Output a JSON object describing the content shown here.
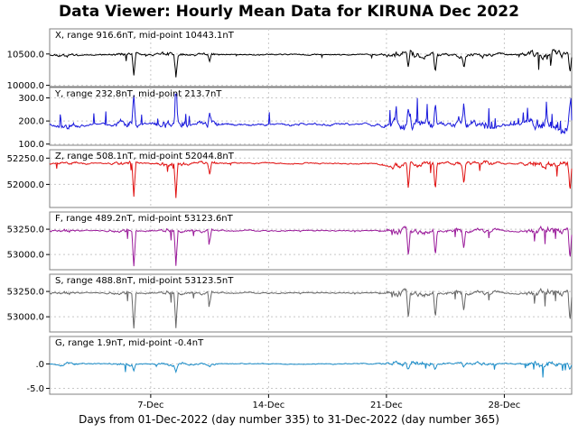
{
  "title": "Data Viewer:  Hourly Mean Data for KIRUNA Dec 2022",
  "chart_data": {
    "type": "line",
    "title": "Data Viewer:  Hourly Mean Data for KIRUNA Dec 2022",
    "xlabel": "Days from 01-Dec-2022 (day number 335) to 31-Dec-2022 (day number 365)",
    "x_start_date": "01-Dec-2022",
    "x_end_date": "31-Dec-2022",
    "xticks": [
      {
        "label": "7-Dec",
        "day": 7
      },
      {
        "label": "14-Dec",
        "day": 14
      },
      {
        "label": "21-Dec",
        "day": 21
      },
      {
        "label": "28-Dec",
        "day": 28
      }
    ],
    "grid": true,
    "panels": [
      {
        "label": "X, range 916.6nT, mid-point 10443.1nT",
        "color": "#000000",
        "ylim": [
          9980,
          10900
        ],
        "ticks": [
          10000.0,
          10500.0
        ],
        "tick_labels": [
          "10000.0",
          "10500.0"
        ],
        "baseline": 10490,
        "noise": 35,
        "dir": -1,
        "spike": 360,
        "seed": 11
      },
      {
        "label": "Y, range 232.8nT, mid-point 213.7nT",
        "color": "#1a1adc",
        "ylim": [
          95,
          345
        ],
        "ticks": [
          100.0,
          200.0,
          300.0
        ],
        "tick_labels": [
          "100.0",
          "200.0",
          "300.0"
        ],
        "baseline": 185,
        "noise": 18,
        "dir": 1,
        "spike": 120,
        "seed": 23
      },
      {
        "label": "Z, range 508.1nT, mid-point 52044.8nT",
        "color": "#e01010",
        "ylim": [
          51780,
          52330
        ],
        "ticks": [
          52000.0,
          52250.0
        ],
        "tick_labels": [
          "52000.0",
          "52250.0"
        ],
        "baseline": 52200,
        "noise": 22,
        "dir": -1,
        "spike": 330,
        "seed": 37
      },
      {
        "label": "F, range 489.2nT, mid-point 53123.6nT",
        "color": "#9a1a9a",
        "ylim": [
          52850,
          53420
        ],
        "ticks": [
          53000.0,
          53250.0
        ],
        "tick_labels": [
          "53000.0",
          "53250.0"
        ],
        "baseline": 53235,
        "noise": 22,
        "dir": -1,
        "spike": 340,
        "seed": 41
      },
      {
        "label": "S, range 488.8nT, mid-point 53123.5nT",
        "color": "#666666",
        "ylim": [
          52850,
          53420
        ],
        "ticks": [
          53000.0,
          53250.0
        ],
        "tick_labels": [
          "53000.0",
          "53250.0"
        ],
        "baseline": 53235,
        "noise": 22,
        "dir": -1,
        "spike": 340,
        "seed": 41
      },
      {
        "label": "G, range 1.9nT, mid-point -0.4nT",
        "color": "#1a8cc8",
        "ylim": [
          -6.2,
          5.6
        ],
        "ticks": [
          -5.0,
          0.0
        ],
        "tick_labels": [
          "-5.0",
          ".0"
        ],
        "baseline": 0.0,
        "noise": 0.35,
        "dir": -1,
        "spike": 1.4,
        "seed": 53
      }
    ]
  }
}
